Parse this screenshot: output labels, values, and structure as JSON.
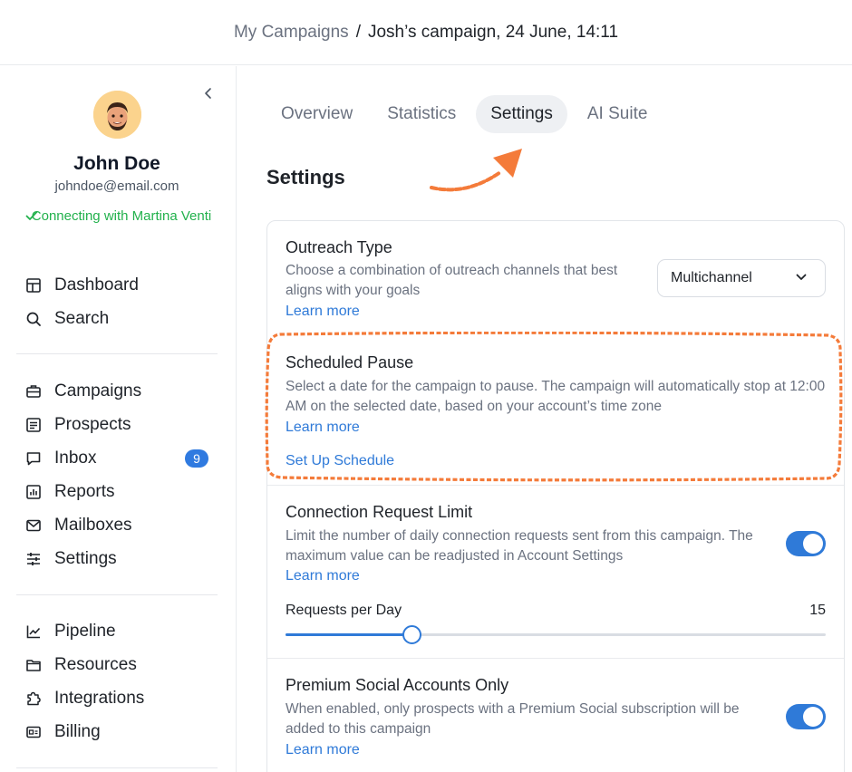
{
  "header": {
    "breadcrumb_root": "My Campaigns",
    "breadcrumb_sep": "/",
    "breadcrumb_current": "Josh’s campaign, 24 June, 14:11"
  },
  "sidebar": {
    "user": {
      "name": "John Doe",
      "email": "johndoe@email.com",
      "status": "Connecting with Martina Venti"
    },
    "groups": [
      [
        {
          "label": "Dashboard",
          "icon": "dashboard-icon"
        },
        {
          "label": "Search",
          "icon": "search-icon"
        }
      ],
      [
        {
          "label": "Campaigns",
          "icon": "briefcase-icon"
        },
        {
          "label": "Prospects",
          "icon": "list-icon"
        },
        {
          "label": "Inbox",
          "icon": "chat-icon",
          "badge": "9"
        },
        {
          "label": "Reports",
          "icon": "bar-chart-icon"
        },
        {
          "label": "Mailboxes",
          "icon": "mail-icon"
        },
        {
          "label": "Settings",
          "icon": "sliders-icon"
        }
      ],
      [
        {
          "label": "Pipeline",
          "icon": "line-chart-icon"
        },
        {
          "label": "Resources",
          "icon": "folder-icon"
        },
        {
          "label": "Integrations",
          "icon": "puzzle-icon"
        },
        {
          "label": "Billing",
          "icon": "id-card-icon"
        }
      ]
    ]
  },
  "tabs": [
    {
      "label": "Overview",
      "active": false
    },
    {
      "label": "Statistics",
      "active": false
    },
    {
      "label": "Settings",
      "active": true
    },
    {
      "label": "AI Suite",
      "active": false
    }
  ],
  "page_title": "Settings",
  "sections": {
    "outreach": {
      "title": "Outreach Type",
      "desc": "Choose a combination of outreach channels that best aligns with your goals",
      "learn": "Learn more",
      "select_value": "Multichannel"
    },
    "pause": {
      "title": "Scheduled Pause",
      "desc": "Select a date for the campaign to pause. The campaign will automatically stop at 12:00 AM on the selected date, based on your account’s time zone",
      "learn": "Learn more",
      "action": "Set Up Schedule"
    },
    "limit": {
      "title": "Connection Request Limit",
      "desc": "Limit the number of daily connection requests sent from this campaign. The maximum value can be readjusted in Account Settings",
      "learn": "Learn more",
      "toggle_on": true,
      "requests_label": "Requests per Day",
      "requests_value": "15",
      "slider_fraction": 0.233
    },
    "premium": {
      "title": "Premium Social Accounts Only",
      "desc": "When enabled, only prospects with a Premium Social subscription will be added to this campaign",
      "learn": "Learn more",
      "toggle_on": true
    }
  },
  "colors": {
    "accent": "#2f7ad8",
    "annotation": "#f47b3a",
    "status": "#22b14c"
  }
}
